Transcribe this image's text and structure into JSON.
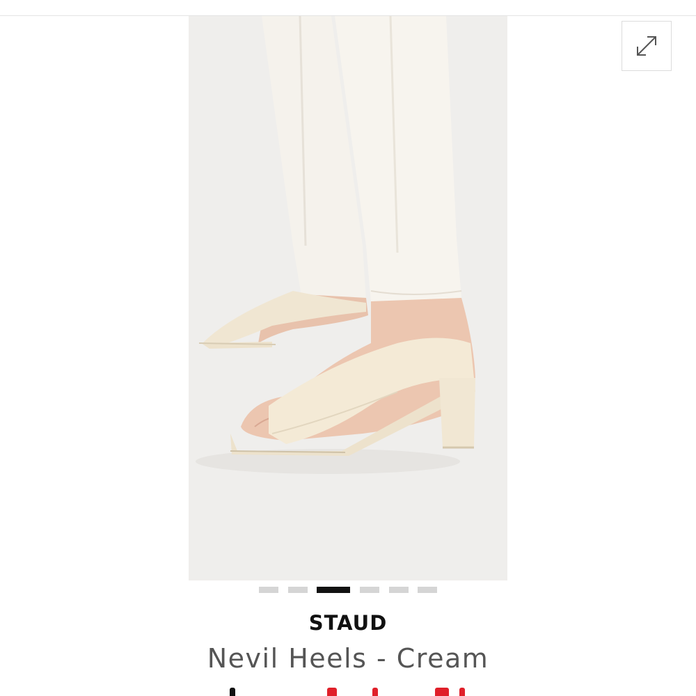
{
  "gallery": {
    "image_alt": "Cream leather square-toe mule with block heel worn with white jeans",
    "expand_icon": "expand-arrows-icon",
    "slide_count": 6,
    "active_slide": 3
  },
  "product": {
    "brand": "STAUD",
    "name": "Nevil Heels - Cream"
  },
  "colors": {
    "sale_price": "#e0202a",
    "regular_text": "#111111",
    "active_dot": "#111111",
    "inactive_dot": "#d5d5d5"
  }
}
